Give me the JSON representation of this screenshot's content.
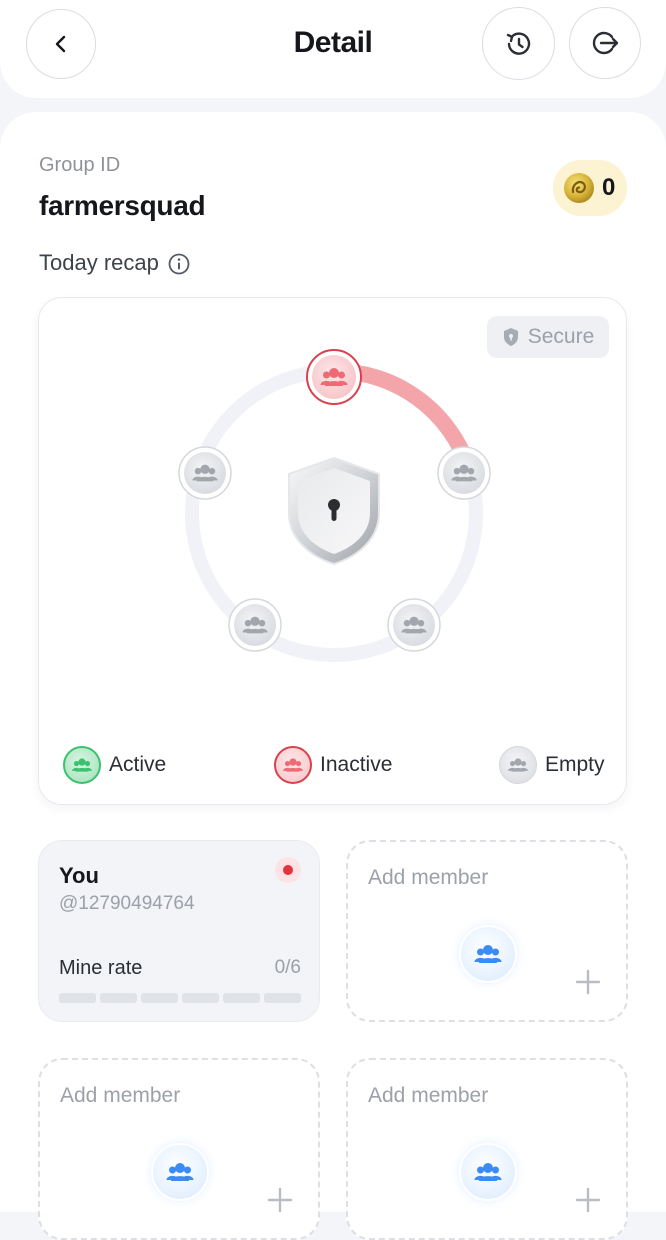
{
  "header": {
    "title": "Detail",
    "back_icon": "chevron-left-icon",
    "history_icon": "history-icon",
    "logout_icon": "logout-icon"
  },
  "group": {
    "id_label": "Group ID",
    "id_value": "farmersquad",
    "coins": "0"
  },
  "recap": {
    "label": "Today recap",
    "secure_label": "Secure",
    "legend": [
      {
        "label": "Active",
        "color": "#3cc16e"
      },
      {
        "label": "Inactive",
        "color": "#e5454f"
      },
      {
        "label": "Empty",
        "color": "#b9bcc2"
      }
    ],
    "slots": [
      {
        "status": "inactive"
      },
      {
        "status": "empty"
      },
      {
        "status": "empty"
      },
      {
        "status": "empty"
      },
      {
        "status": "empty"
      }
    ]
  },
  "members": {
    "you": {
      "name": "You",
      "handle": "@12790494764",
      "mine_rate_label": "Mine rate",
      "mine_rate_value": "0/6",
      "mine_rate_progress": 0
    },
    "add_label": "Add member"
  },
  "colors": {
    "accent_red": "#f0a3a8",
    "accent_blue": "#3b8bf5",
    "coin_bg": "#fcf3d2"
  }
}
